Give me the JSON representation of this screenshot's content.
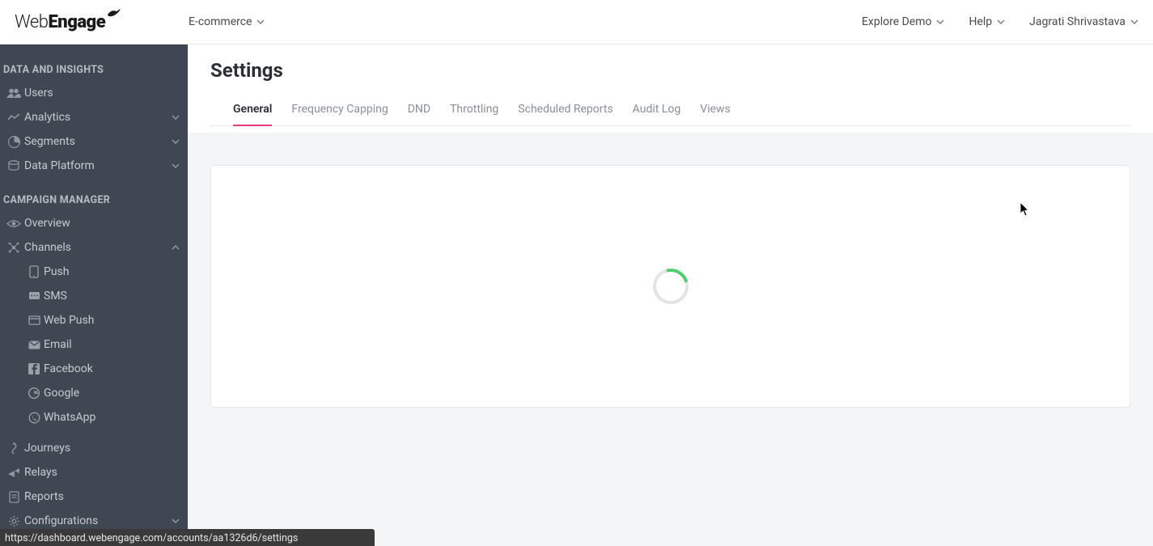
{
  "header": {
    "brand": "WebEngage",
    "workspace": "E-commerce",
    "explore": "Explore Demo",
    "help": "Help",
    "user": "Jagrati Shrivastava"
  },
  "sidebar": {
    "section1": "DATA AND INSIGHTS",
    "users": "Users",
    "analytics": "Analytics",
    "segments": "Segments",
    "data_platform": "Data Platform",
    "section2": "CAMPAIGN MANAGER",
    "overview": "Overview",
    "channels": "Channels",
    "push": "Push",
    "sms": "SMS",
    "web_push": "Web Push",
    "email": "Email",
    "facebook": "Facebook",
    "google": "Google",
    "whatsapp": "WhatsApp",
    "journeys": "Journeys",
    "relays": "Relays",
    "reports": "Reports",
    "configurations": "Configurations"
  },
  "page": {
    "title": "Settings",
    "tabs": {
      "general": "General",
      "frequency_capping": "Frequency Capping",
      "dnd": "DND",
      "throttling": "Throttling",
      "scheduled_reports": "Scheduled Reports",
      "audit_log": "Audit Log",
      "views": "Views"
    }
  },
  "status_url": "https://dashboard.webengage.com/accounts/aa1326d6/settings"
}
